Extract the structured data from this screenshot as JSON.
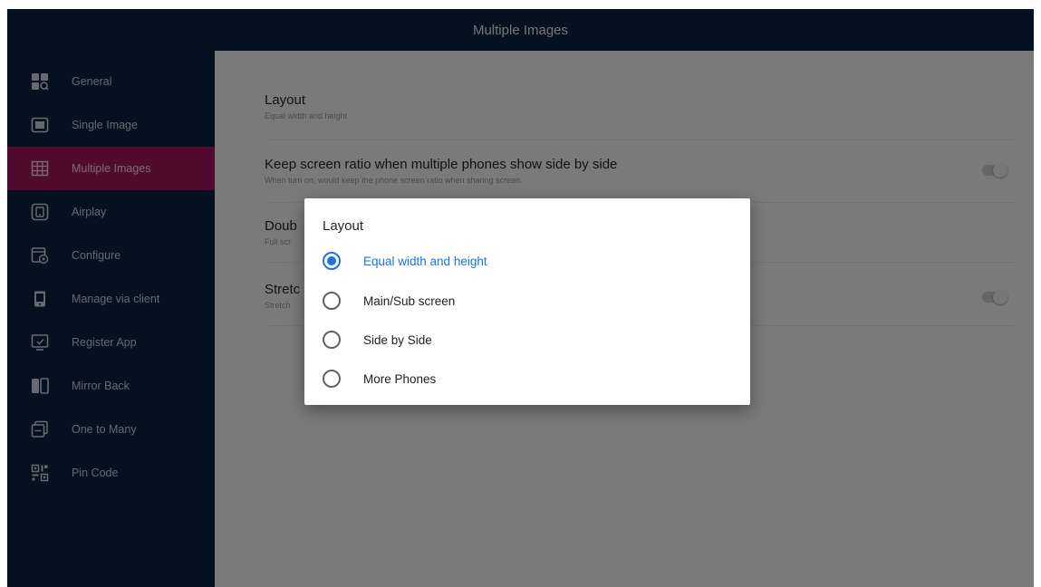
{
  "window": {
    "title": "Multiple Images"
  },
  "sidebar": {
    "items": [
      {
        "label": "General",
        "icon": "general-settings-icon"
      },
      {
        "label": "Single Image",
        "icon": "single-image-icon"
      },
      {
        "label": "Multiple Images",
        "icon": "grid-icon",
        "active": true
      },
      {
        "label": "Airplay",
        "icon": "airplay-icon"
      },
      {
        "label": "Configure",
        "icon": "configure-icon"
      },
      {
        "label": "Manage via client",
        "icon": "client-icon"
      },
      {
        "label": "Register App",
        "icon": "register-app-icon"
      },
      {
        "label": "Mirror Back",
        "icon": "mirror-back-icon"
      },
      {
        "label": "One to Many",
        "icon": "one-to-many-icon"
      },
      {
        "label": "Pin Code",
        "icon": "qr-code-icon"
      }
    ]
  },
  "settings": {
    "layout": {
      "title": "Layout",
      "subtitle": "Equal width and height"
    },
    "keep_ratio": {
      "title": "Keep screen ratio when multiple phones show side by side",
      "subtitle": "When turn on, would keep the phone screen ratio when sharing screen.",
      "toggle_on": false
    },
    "double": {
      "title": "Doub",
      "subtitle": "Full scr"
    },
    "stretch": {
      "title": "Stretc",
      "subtitle": "Stretch",
      "toggle_on": false
    }
  },
  "dialog": {
    "title": "Layout",
    "options": [
      {
        "label": "Equal width and height",
        "checked": true
      },
      {
        "label": "Main/Sub screen",
        "checked": false
      },
      {
        "label": "Side by Side",
        "checked": false
      },
      {
        "label": "More Phones",
        "checked": false
      }
    ]
  },
  "colors": {
    "sidebar_bg": "#0b2340",
    "active_item": "#a3175f",
    "accent": "#1a73e8"
  }
}
